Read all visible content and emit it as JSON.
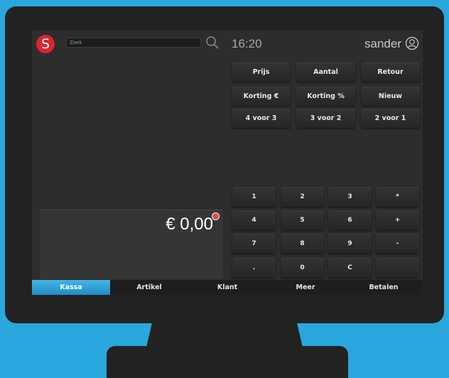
{
  "app": {
    "logo_letter": "S",
    "brand_color": "#d9252d",
    "accent_color": "#2aa7dc"
  },
  "header": {
    "search_placeholder": "Zoek",
    "search_icon": "search-icon",
    "time": "16:20",
    "user": "sander",
    "user_icon": "user-icon"
  },
  "function_buttons": [
    {
      "label": "Prijs"
    },
    {
      "label": "Aantal"
    },
    {
      "label": "Retour"
    },
    {
      "label": "Korting €"
    },
    {
      "label": "Korting %"
    },
    {
      "label": "Nieuw"
    },
    {
      "label": "4 voor 3"
    },
    {
      "label": "3 voor 2"
    },
    {
      "label": "2 voor 1"
    }
  ],
  "keypad": [
    {
      "label": "1"
    },
    {
      "label": "2"
    },
    {
      "label": "3"
    },
    {
      "label": "*"
    },
    {
      "label": "4"
    },
    {
      "label": "5"
    },
    {
      "label": "6"
    },
    {
      "label": "+"
    },
    {
      "label": "7"
    },
    {
      "label": "8"
    },
    {
      "label": "9"
    },
    {
      "label": "-"
    },
    {
      "label": "."
    },
    {
      "label": "0"
    },
    {
      "label": "C"
    },
    {
      "label": ""
    }
  ],
  "total": {
    "amount": "€ 0,00"
  },
  "tabs": [
    {
      "label": "Kassa",
      "active": true
    },
    {
      "label": "Artikel",
      "active": false
    },
    {
      "label": "Klant",
      "active": false
    },
    {
      "label": "Meer",
      "active": false
    },
    {
      "label": "Betalen",
      "active": false
    }
  ]
}
